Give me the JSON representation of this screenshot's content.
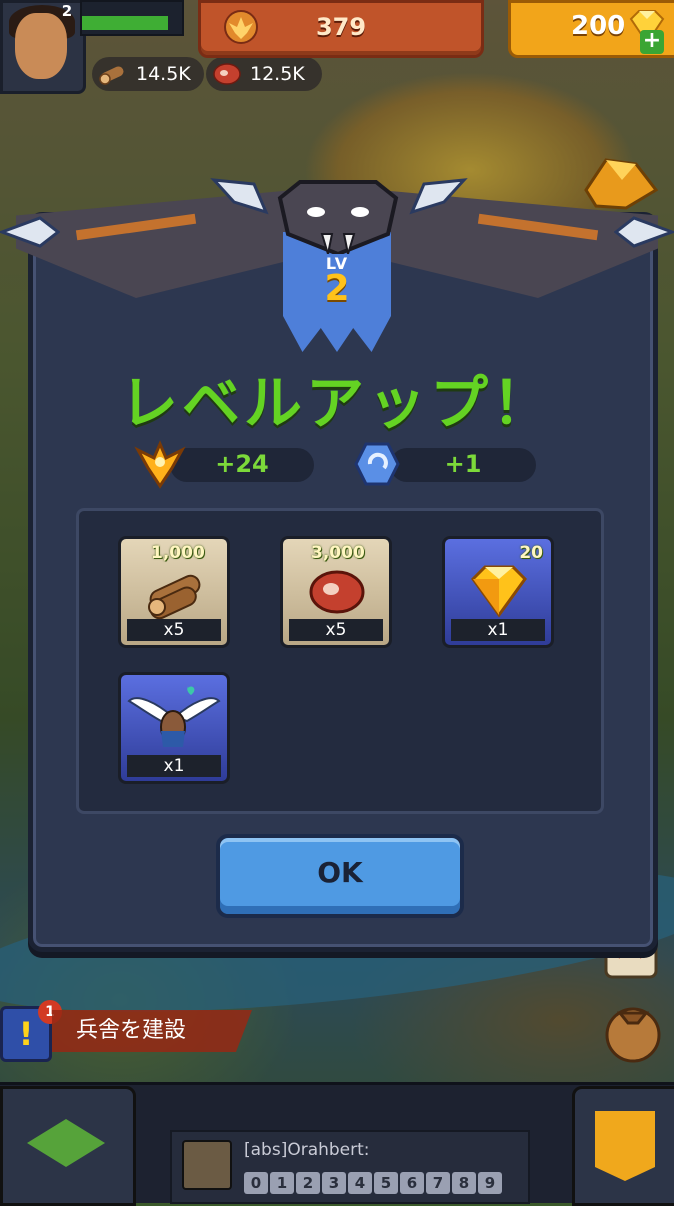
{
  "player": {
    "level": "2",
    "xp_fraction": 0.86
  },
  "resources": {
    "wood": "14.5K",
    "meat": "12.5K",
    "gold": "379",
    "gems": "200"
  },
  "modal": {
    "badge_lv": "LV",
    "badge_level": "2",
    "title": "レベルアップ！",
    "power_gain": "+24",
    "skill_gain": "+1",
    "rewards": [
      {
        "name": "wood",
        "amount": "1,000",
        "qty": "x5"
      },
      {
        "name": "meat",
        "amount": "3,000",
        "qty": "x5"
      },
      {
        "name": "gems",
        "amount": "20",
        "qty": "x1"
      },
      {
        "name": "flying-pet",
        "amount": "",
        "qty": "x1"
      }
    ],
    "ok_label": "OK"
  },
  "quest": {
    "badge": "1",
    "label": "兵舎を建設",
    "icon": "!"
  },
  "chat": {
    "name": "[abs]Orahbert:",
    "digits": [
      "0",
      "1",
      "2",
      "3",
      "4",
      "5",
      "6",
      "7",
      "8",
      "9"
    ]
  },
  "colors": {
    "title_green": "#64d323",
    "panel": "#2d3750",
    "ok_blue": "#4f9ae3"
  }
}
